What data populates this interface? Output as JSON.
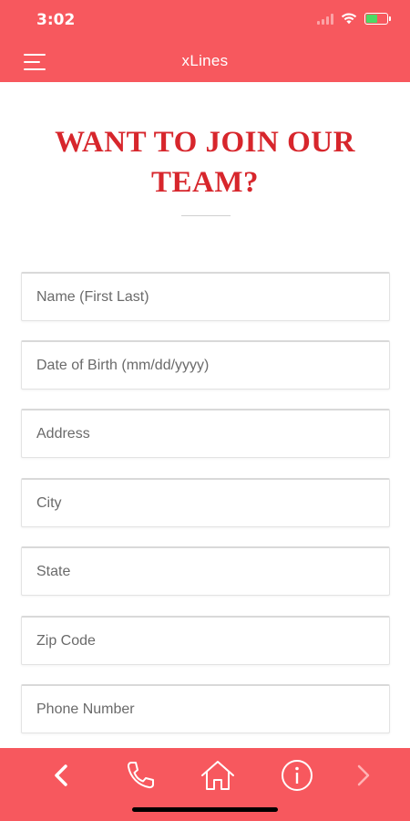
{
  "status_bar": {
    "time": "3:02",
    "icons": [
      "signal-icon",
      "wifi-icon",
      "battery-icon"
    ],
    "battery_color": "#4cd964",
    "battery_level": 0.55
  },
  "navbar": {
    "title": "xLines",
    "menu_icon": "menu-icon"
  },
  "heading": {
    "line1": "WANT TO JOIN OUR",
    "line2": "TEAM?"
  },
  "form": {
    "fields": [
      {
        "placeholder": "Name (First Last)",
        "value": ""
      },
      {
        "placeholder": "Date of Birth (mm/dd/yyyy)",
        "value": ""
      },
      {
        "placeholder": "Address",
        "value": ""
      },
      {
        "placeholder": "City",
        "value": ""
      },
      {
        "placeholder": "State",
        "value": ""
      },
      {
        "placeholder": "Zip Code",
        "value": ""
      },
      {
        "placeholder": "Phone Number",
        "value": ""
      }
    ]
  },
  "tab_bar": {
    "items": [
      "back-icon",
      "phone-icon",
      "home-icon",
      "info-icon",
      "forward-icon"
    ]
  },
  "colors": {
    "brand": "#f7585e",
    "heading": "#d7262c",
    "tab_icon": "#ffffff",
    "tab_icon_disabled": "#ffb3b5"
  }
}
